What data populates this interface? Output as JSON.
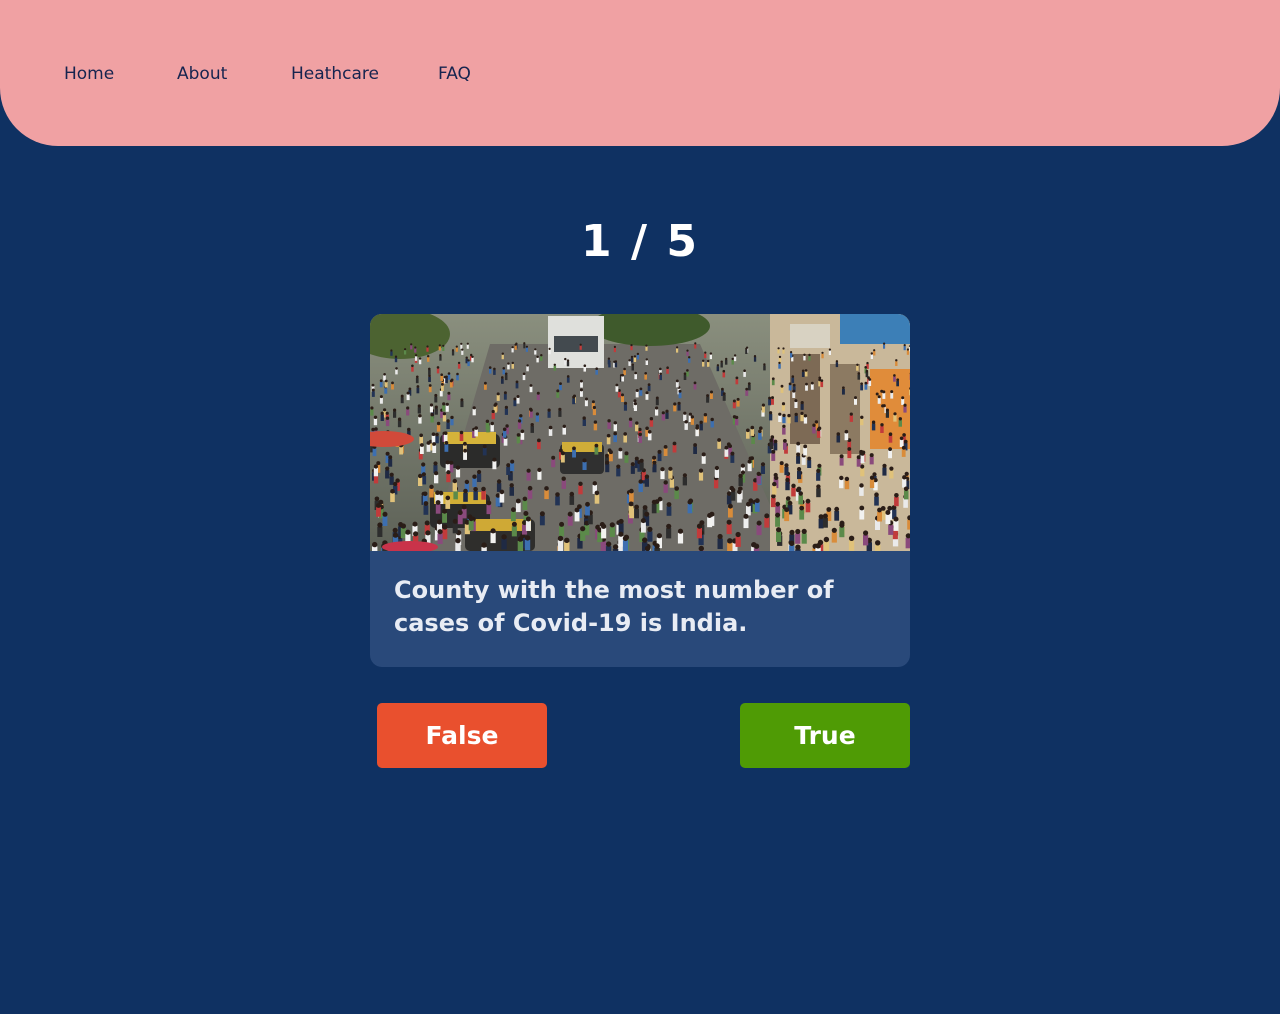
{
  "nav": {
    "items": [
      {
        "label": "Home"
      },
      {
        "label": "About"
      },
      {
        "label": "Heathcare"
      },
      {
        "label": "FAQ"
      }
    ]
  },
  "quiz": {
    "progress": "1 / 5",
    "question": "County with the most number of cases of Covid-19 is India.",
    "false_label": "False",
    "true_label": "True"
  },
  "colors": {
    "background": "#0f3162",
    "navbar": "#f0a1a3",
    "card": "#29497a",
    "false_button": "#e9502e",
    "true_button": "#4f9b05"
  }
}
